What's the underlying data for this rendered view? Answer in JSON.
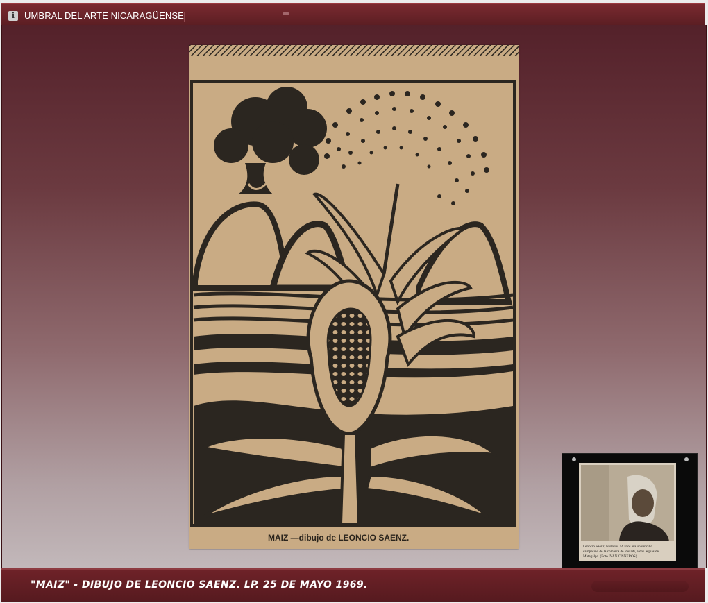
{
  "header": {
    "title": "UMBRAL DEL ARTE NICARAGÜENSE",
    "info_icon": "info-icon"
  },
  "artwork": {
    "printed_caption": "MAIZ —dibujo de  LEONCIO SAENZ."
  },
  "thumbnail": {
    "caption_lines": [
      "Leoncio Saenz, hasta los 14 años era un sencillo",
      "campesino de la comarca de Pasladi, a dos leguas de",
      "Matagalpa. (Foto IVAN CISNEROS)."
    ]
  },
  "footer": {
    "caption": "\"MAIZ\" - DIBUJO  DE LEONCIO SAENZ. LP. 25 DE MAYO 1969."
  },
  "colors": {
    "bar": "#6e2228",
    "paper": "#c9ab84",
    "ink": "#2b2620"
  }
}
